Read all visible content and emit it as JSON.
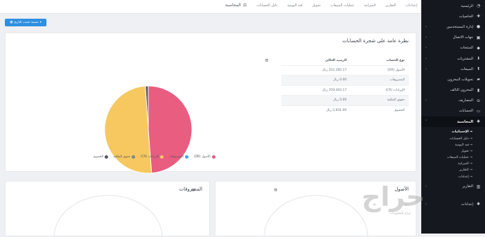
{
  "sidebar": {
    "items": [
      {
        "label": "الرئيسية",
        "icon": "dashboard-icon"
      },
      {
        "label": "الخاصيات",
        "icon": "puzzle-icon"
      },
      {
        "label": "إدارة المستخدمين",
        "icon": "users-icon",
        "chevron": true
      },
      {
        "label": "جهات الاتصال",
        "icon": "contacts-icon",
        "chevron": true
      },
      {
        "label": "المنتجات",
        "icon": "cube-icon",
        "chevron": true
      },
      {
        "label": "المشتريات",
        "icon": "download-icon",
        "chevron": true
      },
      {
        "label": "المبيعات",
        "icon": "upload-icon",
        "chevron": true
      },
      {
        "label": "تحويلات المخزون",
        "icon": "truck-icon"
      },
      {
        "label": "المخزون التالف",
        "icon": "trash-icon"
      },
      {
        "label": "المصاريف",
        "icon": "minus-circle-icon",
        "chevron": true
      },
      {
        "label": "الحسابات",
        "icon": "money-icon"
      },
      {
        "label": "المحاسبة",
        "icon": "gear-icon",
        "chevron": true,
        "active": true
      }
    ],
    "sub_items": [
      "الإحصائيات",
      "دليل الحسابات",
      "قيد اليومية",
      "تحويل",
      "عمليات المبيعات",
      "الميزانية",
      "التقارير",
      "إعدادات"
    ],
    "bottom_items": [
      {
        "label": "التقارير",
        "icon": "chart-icon",
        "chevron": true
      },
      {
        "label": "إعدادات",
        "icon": "gear-icon",
        "chevron": true
      }
    ]
  },
  "topbar": {
    "account_label": "المحاسبة",
    "nav": [
      "دليل الحسابات",
      "قيد اليومية",
      "تحويل",
      "عمليات المبيعات",
      "الميزانية",
      "التقارير",
      "إعدادات"
    ]
  },
  "toolbar": {
    "filter_label": "تصفية حسب التاريخ"
  },
  "overview": {
    "title": "نظرة عامة على شجرة الحسابات",
    "columns": [
      "نوع الحساب",
      "الرصيد الحالي"
    ],
    "rows": [
      {
        "type": "الأصول (DR)",
        "balance": "252,282.17 ريال"
      },
      {
        "type": "المصروفات",
        "balance": "0.00 ريال"
      },
      {
        "type": "الإيرادات (CR)",
        "balance": "259,403.17 ريال"
      },
      {
        "type": "حقوق الملكية",
        "balance": "0.00 ريال"
      },
      {
        "type": "الخصوم",
        "balance": "5,641.00 ريال"
      }
    ]
  },
  "chart_data": {
    "type": "pie",
    "series": [
      {
        "name": "الخصوم",
        "value": 5641.0,
        "color": "#555b66"
      },
      {
        "name": "حقوق الملكية",
        "value": 0.0,
        "color": "#7d8694"
      },
      {
        "name": "الإيرادات (CR)",
        "value": 259403.17,
        "color": "#f6c85f"
      },
      {
        "name": "المصروفات",
        "value": 0.0,
        "color": "#4aa3df"
      },
      {
        "name": "الأصول (DR)",
        "value": 252282.17,
        "color": "#e85d80"
      }
    ]
  },
  "assets_card": {
    "title": "الأصول"
  },
  "expenses_card": {
    "title": "المصروفات"
  },
  "watermark": {
    "text": "حراج",
    "subtext": "حراج للمعلومات"
  }
}
